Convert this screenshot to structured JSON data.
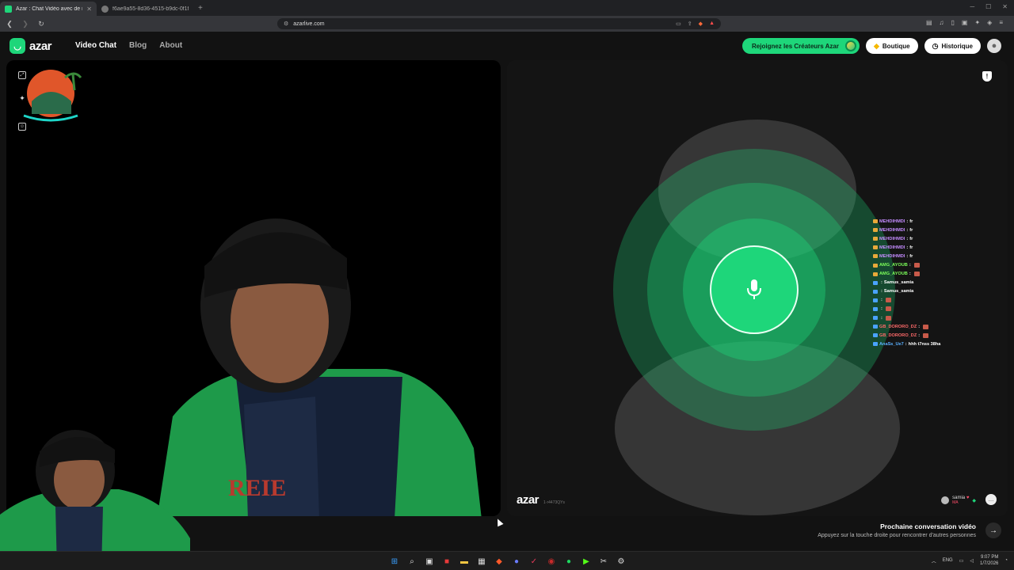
{
  "browser": {
    "tabs": [
      {
        "title": "Azar : Chat Vidéo avec de no",
        "active": true
      },
      {
        "title": "f6ae9a55-8d36-4515-b9dc-0f1f0a65",
        "active": false
      }
    ],
    "url": "azarlive.com"
  },
  "header": {
    "logo_text": "azar",
    "nav": [
      "Video Chat",
      "Blog",
      "About"
    ],
    "creators_label": "Rejoignez les Créateurs Azar",
    "shop_label": "Boutique",
    "history_label": "Historique"
  },
  "left_panel": {
    "icons": [
      "expand-icon",
      "sparkle-icon",
      "mask-icon"
    ]
  },
  "right_panel": {
    "brand": "azar",
    "session_id": "1·r4473QYs",
    "partner_name": "samia",
    "partner_country": "MA",
    "mic_icon": "microphone-icon",
    "accent": "#1ed67a"
  },
  "chat": [
    {
      "user": "MEHDIHMDI",
      "msg": "fr",
      "color": "#c58cff"
    },
    {
      "user": "MEHDIHMDI",
      "msg": "fr",
      "color": "#c58cff"
    },
    {
      "user": "MEHDIHMDI",
      "msg": "fr",
      "color": "#c58cff"
    },
    {
      "user": "MEHDIHMDI",
      "msg": "fr",
      "color": "#c58cff"
    },
    {
      "user": "MEHDIHMDI",
      "msg": "fr",
      "color": "#c58cff"
    },
    {
      "user": "AMG_AYOUB",
      "msg": "",
      "color": "#7cff5a"
    },
    {
      "user": "AMG_AYOUB",
      "msg": "",
      "color": "#7cff5a"
    },
    {
      "user": "",
      "msg": "Samus_samia",
      "color": "#ff3b3b"
    },
    {
      "user": "",
      "msg": "Samus_samia",
      "color": "#ff3b3b"
    },
    {
      "user": "",
      "msg": "",
      "color": "#ff3b3b"
    },
    {
      "user": "",
      "msg": "",
      "color": "#ff3b3b"
    },
    {
      "user": "",
      "msg": "",
      "color": "#ff3b3b"
    },
    {
      "user": "GB_DORORO_DZ",
      "msg": "",
      "color": "#ff6a6a"
    },
    {
      "user": "GB_DORORO_DZ",
      "msg": "",
      "color": "#ff6a6a"
    },
    {
      "user": "AnaSs_Ue7",
      "msg": "hhh t7nss 38ha",
      "color": "#5ab0ff"
    }
  ],
  "next": {
    "title": "Prochaine conversation vidéo",
    "subtitle": "Appuyez sur la touche droite pour rencontrer d'autres personnes"
  },
  "taskbar": {
    "lang": "ENG",
    "time": "9:07 PM",
    "date": "1/7/2026"
  }
}
